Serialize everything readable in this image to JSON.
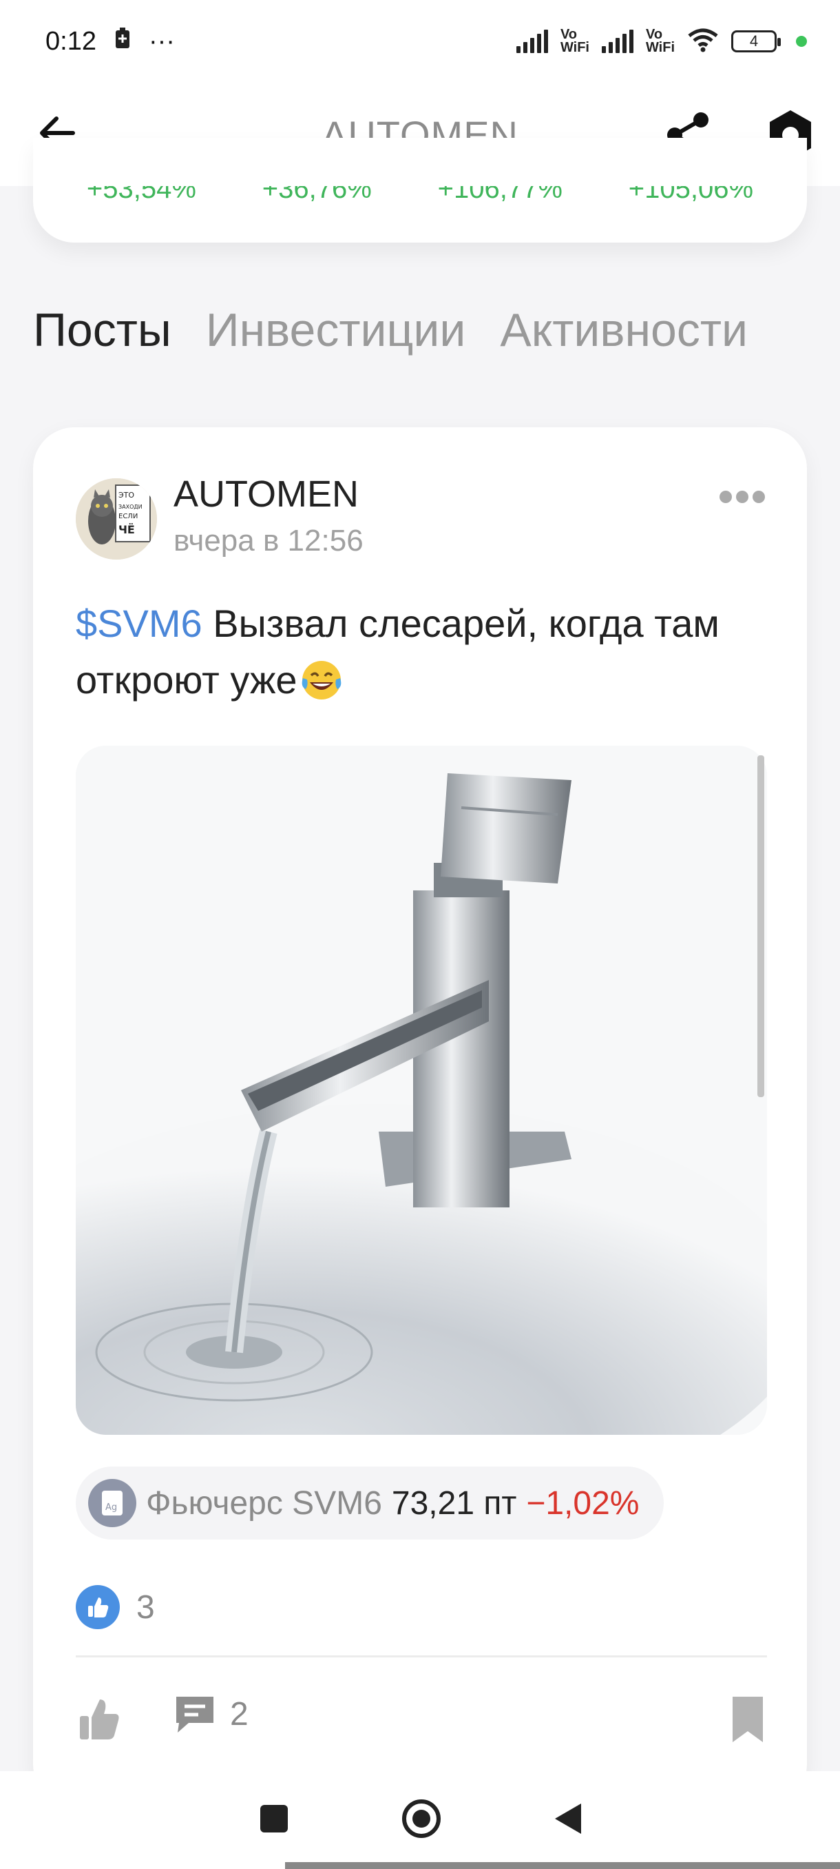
{
  "status_bar": {
    "time": "0:12",
    "dots": "···",
    "vowifi_1": "Vo\nWiFi",
    "vowifi_2": "Vo\nWiFi",
    "battery": "4"
  },
  "header": {
    "title": "AUTOMEN"
  },
  "stats_card": {
    "values": [
      "+53,54%",
      "+36,76%",
      "+106,77%",
      "+105,06%"
    ]
  },
  "tabs": [
    {
      "label": "Посты",
      "active": true
    },
    {
      "label": "Инвестиции",
      "active": false
    },
    {
      "label": "Активности",
      "active": false
    }
  ],
  "post": {
    "author": "AUTOMEN",
    "time": "вчера в 12:56",
    "ticker": "$SVM6",
    "text": " Вызвал слесарей, когда там откроют уже",
    "instrument": {
      "name": "Фьючерс SVM6",
      "price": "73,21 пт",
      "change": "−1,02%"
    },
    "likes": "3",
    "comments": "2"
  },
  "colors": {
    "accent_blue": "#4a86d8",
    "positive_green": "#3fb55a",
    "negative_red": "#d9342b",
    "muted_text": "#999999"
  }
}
